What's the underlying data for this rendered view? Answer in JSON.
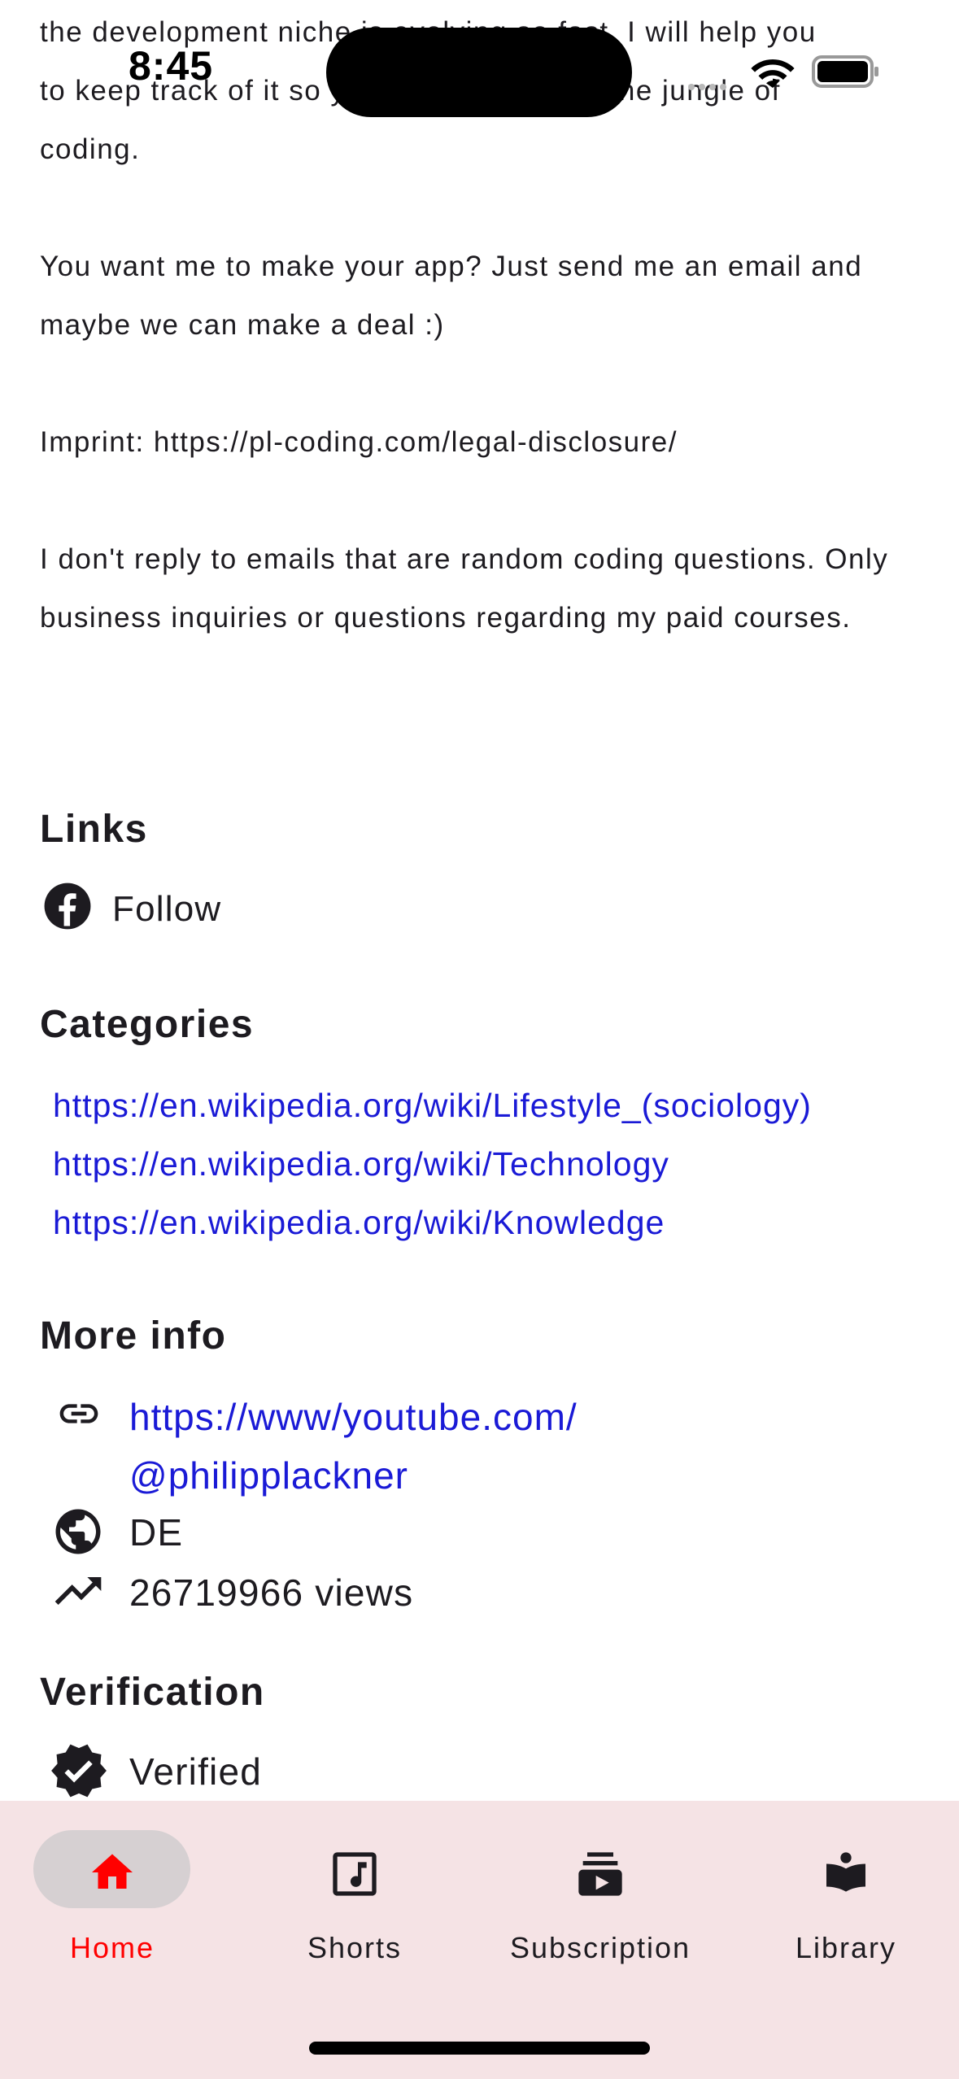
{
  "status_bar": {
    "time": "8:45"
  },
  "about": {
    "line_top_a": "the development niche is evolving so fast, I will help you",
    "line_top_b": "to keep track of it so you don't get lost in the jungle of",
    "line_top_c": "coding.",
    "para_app": "You want me to make your app? Just send me an email and maybe we can make a deal :)",
    "imprint": "Imprint: https://pl-coding.com/legal-disclosure/",
    "para_reply": "I don't reply to emails that are random coding questions. Only business inquiries or questions regarding my paid courses."
  },
  "links": {
    "heading": "Links",
    "items": [
      {
        "icon": "facebook-icon",
        "label": "Follow"
      }
    ]
  },
  "categories": {
    "heading": "Categories",
    "items": [
      "https://en.wikipedia.org/wiki/Lifestyle_(sociology)",
      "https://en.wikipedia.org/wiki/Technology",
      "https://en.wikipedia.org/wiki/Knowledge"
    ]
  },
  "more_info": {
    "heading": "More info",
    "url_line1": "https://www/youtube.com/",
    "url_line2": "@philipplackner",
    "country": "DE",
    "views": "26719966 views"
  },
  "verification": {
    "heading": "Verification",
    "status": "Verified"
  },
  "bottom_nav": {
    "items": [
      {
        "label": "Home",
        "icon": "home-icon",
        "active": true
      },
      {
        "label": "Shorts",
        "icon": "music-note-icon",
        "active": false
      },
      {
        "label": "Subscription",
        "icon": "subscriptions-icon",
        "active": false
      },
      {
        "label": "Library",
        "icon": "library-book-icon",
        "active": false
      }
    ]
  },
  "colors": {
    "accent": "#ff0000",
    "link": "#1a1ad6",
    "nav_background": "#f5e3e5",
    "nav_active_pill": "#d6d0d2"
  }
}
